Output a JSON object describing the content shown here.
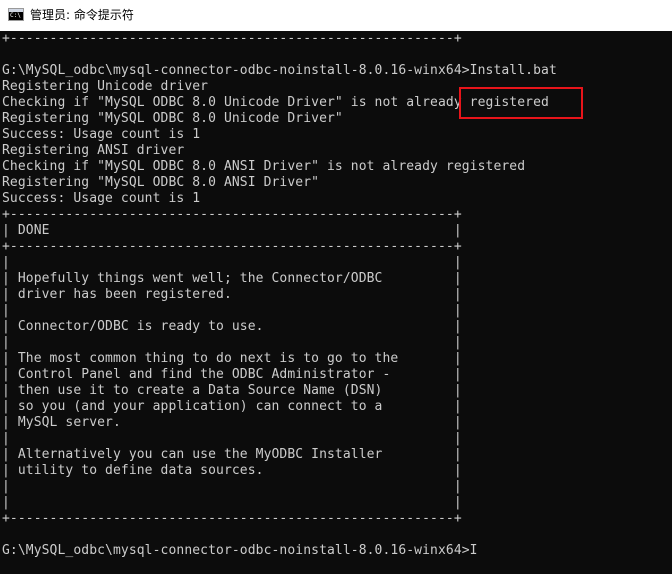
{
  "window": {
    "title": "管理员: 命令提示符",
    "icon": "cmd-icon",
    "icon_prompt": "C:\\"
  },
  "console": {
    "text_color": "#cccccc",
    "background": "#0c0c0c",
    "lines": [
      "+--------------------------------------------------------+",
      "",
      "G:\\MySQL_odbc\\mysql-connector-odbc-noinstall-8.0.16-winx64>Install.bat",
      "Registering Unicode driver",
      "Checking if \"MySQL ODBC 8.0 Unicode Driver\" is not already registered",
      "Registering \"MySQL ODBC 8.0 Unicode Driver\"",
      "Success: Usage count is 1",
      "Registering ANSI driver",
      "Checking if \"MySQL ODBC 8.0 ANSI Driver\" is not already registered",
      "Registering \"MySQL ODBC 8.0 ANSI Driver\"",
      "Success: Usage count is 1",
      "+--------------------------------------------------------+",
      "| DONE                                                   |",
      "+--------------------------------------------------------+",
      "|                                                        |",
      "| Hopefully things went well; the Connector/ODBC         |",
      "| driver has been registered.                            |",
      "|                                                        |",
      "| Connector/ODBC is ready to use.                        |",
      "|                                                        |",
      "| The most common thing to do next is to go to the       |",
      "| Control Panel and find the ODBC Administrator -        |",
      "| then use it to create a Data Source Name (DSN)         |",
      "| so you (and your application) can connect to a         |",
      "| MySQL server.                                          |",
      "|                                                        |",
      "| Alternatively you can use the MyODBC Installer         |",
      "| utility to define data sources.                        |",
      "|                                                        |",
      "|                                                        |",
      "+--------------------------------------------------------+",
      "",
      "G:\\MySQL_odbc\\mysql-connector-odbc-noinstall-8.0.16-winx64>I"
    ]
  },
  "annotation": {
    "highlight_color": "#e8141a",
    "highlighted_text": "Install.bat"
  }
}
